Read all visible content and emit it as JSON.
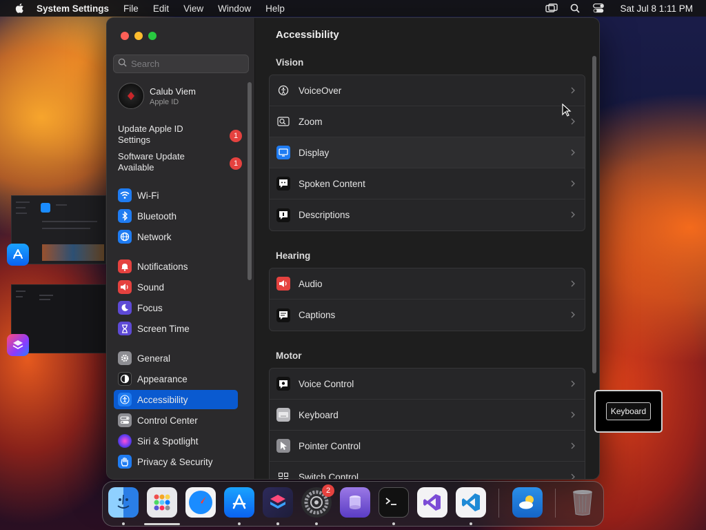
{
  "menubar": {
    "app_name": "System Settings",
    "menus": [
      "File",
      "Edit",
      "View",
      "Window",
      "Help"
    ],
    "clock": "Sat Jul 8  1:11 PM"
  },
  "sidebar": {
    "search_placeholder": "Search",
    "user": {
      "name": "Calub Viem",
      "subtitle": "Apple ID"
    },
    "updates": [
      {
        "label": "Update Apple ID Settings",
        "badge": "1"
      },
      {
        "label": "Software Update Available",
        "badge": "1"
      }
    ],
    "items": [
      {
        "label": "Wi-Fi",
        "icon": "wifi-icon",
        "color": "#1f7cf2"
      },
      {
        "label": "Bluetooth",
        "icon": "bluetooth-icon",
        "color": "#1f7cf2"
      },
      {
        "label": "Network",
        "icon": "globe-icon",
        "color": "#1f7cf2"
      },
      {
        "label": "Notifications",
        "icon": "bell-icon",
        "color": "#e5423f"
      },
      {
        "label": "Sound",
        "icon": "speaker-icon",
        "color": "#e5423f"
      },
      {
        "label": "Focus",
        "icon": "moon-icon",
        "color": "#5e4ad6"
      },
      {
        "label": "Screen Time",
        "icon": "hourglass-icon",
        "color": "#5e4ad6"
      },
      {
        "label": "General",
        "icon": "gear-icon",
        "color": "#8e8e93"
      },
      {
        "label": "Appearance",
        "icon": "appearance-icon",
        "color": "#1c1c1e"
      },
      {
        "label": "Accessibility",
        "icon": "accessibility-icon",
        "color": "#1f7cf2"
      },
      {
        "label": "Control Center",
        "icon": "control-center-icon",
        "color": "#8e8e93"
      },
      {
        "label": "Siri & Spotlight",
        "icon": "siri-icon",
        "color": "#a24bd6"
      },
      {
        "label": "Privacy & Security",
        "icon": "hand-icon",
        "color": "#1f7cf2"
      }
    ],
    "selected": "Accessibility"
  },
  "content": {
    "title": "Accessibility",
    "sections": [
      {
        "title": "Vision",
        "rows": [
          {
            "label": "VoiceOver",
            "icon": "voiceover-icon"
          },
          {
            "label": "Zoom",
            "icon": "zoom-icon"
          },
          {
            "label": "Display",
            "icon": "display-icon"
          },
          {
            "label": "Spoken Content",
            "icon": "spoken-content-icon"
          },
          {
            "label": "Descriptions",
            "icon": "descriptions-icon"
          }
        ]
      },
      {
        "title": "Hearing",
        "rows": [
          {
            "label": "Audio",
            "icon": "audio-icon"
          },
          {
            "label": "Captions",
            "icon": "captions-icon"
          }
        ]
      },
      {
        "title": "Motor",
        "rows": [
          {
            "label": "Voice Control",
            "icon": "voice-control-icon"
          },
          {
            "label": "Keyboard",
            "icon": "keyboard-icon"
          },
          {
            "label": "Pointer Control",
            "icon": "pointer-control-icon"
          },
          {
            "label": "Switch Control",
            "icon": "switch-control-icon"
          }
        ]
      }
    ]
  },
  "tooltip": {
    "label": "Keyboard"
  },
  "dock": {
    "apps": [
      "Finder",
      "Launchpad",
      "Safari",
      "App Store",
      "Shortcuts",
      "System Settings",
      "Apple Configurator",
      "Terminal",
      "Visual Studio",
      "Visual Studio Code",
      "Weather",
      "Trash"
    ],
    "system_settings_badge": "2"
  }
}
